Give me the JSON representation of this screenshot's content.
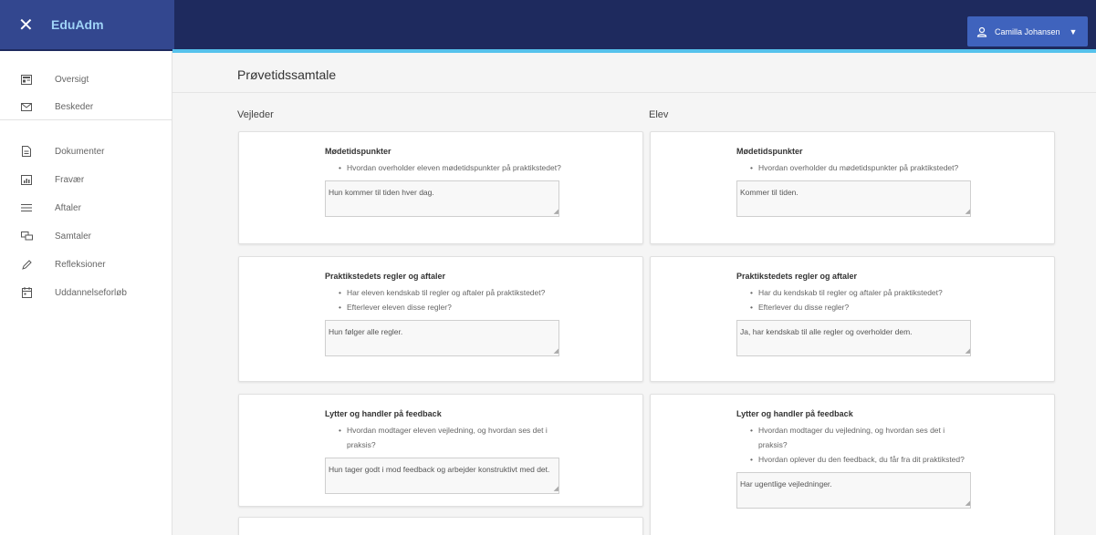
{
  "app": {
    "name": "EduAdm"
  },
  "user": {
    "name": "Camilla Johansen"
  },
  "sidebar": {
    "items": [
      {
        "label": "Oversigt",
        "icon": "dashboard-icon"
      },
      {
        "label": "Beskeder",
        "icon": "mail-icon"
      },
      {
        "label": "Dokumenter",
        "icon": "document-icon"
      },
      {
        "label": "Fravær",
        "icon": "chart-icon"
      },
      {
        "label": "Aftaler",
        "icon": "list-icon"
      },
      {
        "label": "Samtaler",
        "icon": "chat-icon"
      },
      {
        "label": "Refleksioner",
        "icon": "pencil-icon"
      },
      {
        "label": "Uddannelseforløb",
        "icon": "calendar-icon"
      }
    ]
  },
  "page": {
    "title": "Prøvetidssamtale"
  },
  "columns": {
    "left": "Vejleder",
    "right": "Elev"
  },
  "vejleder": [
    {
      "title": "Mødetidspunkter",
      "bullets": [
        "Hvordan overholder eleven mødetidspunkter på praktikstedet?"
      ],
      "answer": "Hun kommer til tiden hver dag."
    },
    {
      "title": "Praktikstedets regler og aftaler",
      "bullets": [
        "Har eleven kendskab til regler og aftaler på praktikstedet?",
        "Efterlever eleven disse regler?"
      ],
      "answer": "Hun følger alle regler."
    },
    {
      "title": "Lytter og handler på feedback",
      "bullets": [
        "Hvordan modtager eleven vejledning, og hvordan ses det i praksis?"
      ],
      "answer": "Hun tager godt i mod feedback og arbejder konstruktivt med det."
    }
  ],
  "elev": [
    {
      "title": "Mødetidspunkter",
      "bullets": [
        "Hvordan overholder du mødetidspunkter på praktikstedet?"
      ],
      "answer": "Kommer til tiden."
    },
    {
      "title": "Praktikstedets regler og aftaler",
      "bullets": [
        "Har du kendskab til regler og aftaler på praktikstedet?",
        "Efterlever du disse regler?"
      ],
      "answer": "Ja, har kendskab til alle regler og overholder dem."
    },
    {
      "title": "Lytter og handler på feedback",
      "bullets": [
        "Hvordan modtager du vejledning, og hvordan ses det i praksis?",
        "Hvordan oplever du den feedback, du får fra dit praktiksted?"
      ],
      "answer": "Har ugentlige vejledninger."
    }
  ],
  "colors": {
    "topbar": "#1e2a5e",
    "brand_bg": "#33478f",
    "accent": "#56c2ec",
    "user_button": "#3f63bd"
  }
}
